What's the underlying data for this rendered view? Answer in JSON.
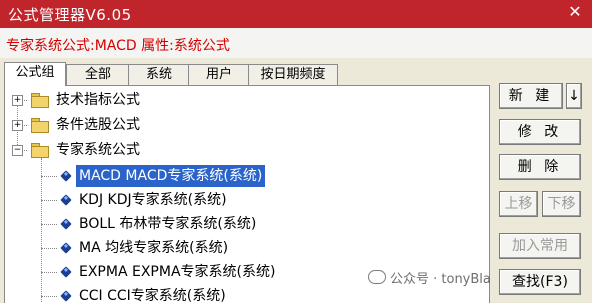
{
  "window": {
    "title": "公式管理器V6.05"
  },
  "info_line": "专家系统公式:MACD 属性:系统公式",
  "tabs": [
    {
      "label": "公式组"
    },
    {
      "label": "全部"
    },
    {
      "label": "系统"
    },
    {
      "label": "用户"
    },
    {
      "label": "按日期频度"
    }
  ],
  "tree": {
    "groups": [
      {
        "label": "技术指标公式",
        "expander": "+"
      },
      {
        "label": "条件选股公式",
        "expander": "+"
      },
      {
        "label": "专家系统公式",
        "expander": "−"
      }
    ],
    "items": [
      {
        "label": "MACD  MACD专家系统(系统)"
      },
      {
        "label": "KDJ  KDJ专家系统(系统)"
      },
      {
        "label": "BOLL  布林带专家系统(系统)"
      },
      {
        "label": "MA  均线专家系统(系统)"
      },
      {
        "label": "EXPMA  EXPMA专家系统(系统)"
      },
      {
        "label": "CCI  CCI专家系统(系统)"
      }
    ]
  },
  "buttons": {
    "new": "新 建",
    "new_arrow": "↓",
    "modify": "修 改",
    "delete": "删 除",
    "move_up": "上移",
    "move_down": "下移",
    "add_common": "加入常用",
    "find": "查找(F3)"
  },
  "watermark": "公众号 · tonyBla"
}
